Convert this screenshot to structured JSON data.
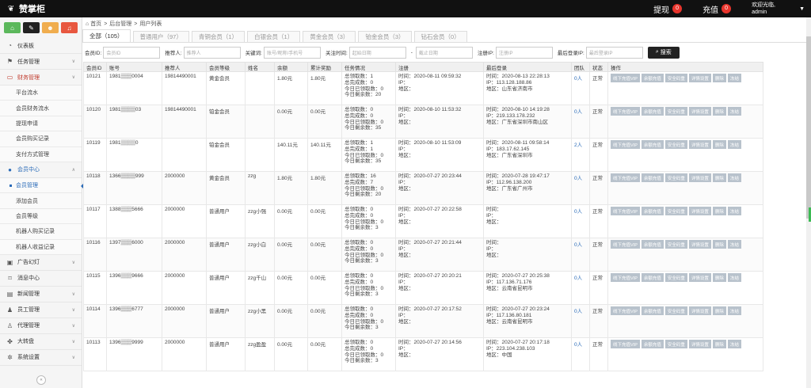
{
  "brand": {
    "name": "赞掌柜",
    "icon": "leaf-icon"
  },
  "topbar": {
    "withdraw_label": "提现",
    "withdraw_count": "0",
    "recharge_label": "充值",
    "recharge_count": "0",
    "welcome": "欢迎光临,",
    "username": "admin"
  },
  "sidebar": {
    "quick": [
      "home-icon",
      "pencil-icon",
      "group-icon",
      "bell-icon"
    ],
    "items": [
      {
        "label": "仪表板",
        "icon": "gauge-icon",
        "chev": ""
      },
      {
        "label": "任务管理",
        "icon": "flag-icon",
        "chev": "∨"
      },
      {
        "label": "财务管理",
        "icon": "card-icon",
        "chev": "∨",
        "state": "active"
      },
      {
        "label": "平台流水",
        "sub": true
      },
      {
        "label": "会员财务流水",
        "sub": true
      },
      {
        "label": "提现申请",
        "sub": true
      },
      {
        "label": "会员购买记录",
        "sub": true
      },
      {
        "label": "支付方式管理",
        "sub": true
      },
      {
        "label": "会员中心",
        "icon": "user-icon",
        "chev": "∧",
        "state": "active-blue"
      },
      {
        "label": "会员管理",
        "sub": true,
        "current": true
      },
      {
        "label": "添加会员",
        "sub": true
      },
      {
        "label": "会员等级",
        "sub": true
      },
      {
        "label": "机器人购买记录",
        "sub": true
      },
      {
        "label": "机器人收益记录",
        "sub": true
      },
      {
        "label": "广告幻灯",
        "icon": "image-icon",
        "chev": "∨"
      },
      {
        "label": "消息中心",
        "icon": "bookmark-icon",
        "chev": ""
      },
      {
        "label": "新闻管理",
        "icon": "news-icon",
        "chev": "∨"
      },
      {
        "label": "员工管理",
        "icon": "staff-icon",
        "chev": "∨"
      },
      {
        "label": "代理管理",
        "icon": "agent-icon",
        "chev": "∨"
      },
      {
        "label": "大转盘",
        "icon": "wheel-icon",
        "chev": "∨"
      },
      {
        "label": "系统设置",
        "icon": "gear-icon",
        "chev": "∨"
      }
    ]
  },
  "breadcrumb": [
    "首页",
    "后台管理",
    "用户列表"
  ],
  "tabs": [
    {
      "label": "全部（105）",
      "active": true
    },
    {
      "label": "普通用户（97）"
    },
    {
      "label": "青铜会员（1）"
    },
    {
      "label": "白银会员（1）"
    },
    {
      "label": "黄金会员（3）"
    },
    {
      "label": "铂金会员（3）"
    },
    {
      "label": "钻石会员（0）"
    }
  ],
  "filters": {
    "member_id_label": "会员ID:",
    "member_id_ph": "会员ID",
    "referrer_label": "推荐人:",
    "referrer_ph": "推荐人",
    "keyword_label": "关键词:",
    "keyword_ph": "账号/昵称/手机号",
    "follow_time_label": "关注时间:",
    "start_ph": "起始日期",
    "dash": "-",
    "end_ph": "截止日期",
    "reg_ip_label": "注册IP:",
    "reg_ip_ph": "注册IP",
    "last_ip_label": "最后登录IP:",
    "last_ip_ph": "最后登录IP",
    "search_label": "搜索"
  },
  "table": {
    "headers": [
      "会员ID",
      "账号",
      "推荐人",
      "会员等级",
      "姓名",
      "余额",
      "累计奖励",
      "任务情况",
      "注册",
      "最后登录",
      "团队",
      "状态",
      "操作"
    ],
    "ops": [
      "线下充值VIP",
      "余额充值",
      "安全码重",
      "详情设置",
      "删除",
      "冻结"
    ],
    "rows": [
      {
        "id": "10121",
        "account": "1981▒▒▒0004",
        "referrer": "19814490001",
        "level": "黄金会员",
        "name": "",
        "balance": "1.80元",
        "reward": "1.80元",
        "task": [
          "总领取数：1",
          "总完成数：0",
          "今日已领取数：0",
          "今日剩余数：20"
        ],
        "reg": [
          "时间：2020-08-11 09:59:32",
          "IP：",
          "地区："
        ],
        "last": [
          "时间：2020-08-13 22:28:13",
          "IP：113.128.188.86",
          "地区：山东省济南市"
        ],
        "team": "0人",
        "status": "正常"
      },
      {
        "id": "10120",
        "account": "1981▒▒▒▒03",
        "referrer": "19814490001",
        "level": "铂金会员",
        "name": "",
        "balance": "0.00元",
        "reward": "0.00元",
        "task": [
          "总领取数：0",
          "总完成数：0",
          "今日已领取数：0",
          "今日剩余数：35"
        ],
        "reg": [
          "时间：2020-08-10 11:53:32",
          "IP：",
          "地区："
        ],
        "last": [
          "时间：2020-08-10 14:19:28",
          "IP：219.133.178.232",
          "地区：广东省深圳市南山区"
        ],
        "team": "0人",
        "status": "正常"
      },
      {
        "id": "10119",
        "account": "1981▒▒▒▒0",
        "referrer": "",
        "level": "铂金会员",
        "name": "",
        "balance": "140.11元",
        "reward": "140.11元",
        "task": [
          "总领取数：1",
          "总完成数：1",
          "今日已领取数：0",
          "今日剩余数：35"
        ],
        "reg": [
          "时间：2020-08-10 11:53:09",
          "IP：",
          "地区："
        ],
        "last": [
          "时间：2020-08-11 09:58:14",
          "IP：183.17.62.145",
          "地区：广东省深圳市"
        ],
        "team": "2人",
        "status": "正常"
      },
      {
        "id": "10118",
        "account": "1366▒▒▒▒999",
        "referrer": "2000000",
        "level": "黄金会员",
        "name": "zzg",
        "balance": "1.80元",
        "reward": "1.80元",
        "task": [
          "总领取数：16",
          "总完成数：7",
          "今日已领取数：0",
          "今日剩余数：20"
        ],
        "reg": [
          "时间：2020-07-27 20:23:44",
          "IP：",
          "地区："
        ],
        "last": [
          "时间：2020-07-28 19:47:17",
          "IP：112.96.138.200",
          "地区：广东省广州市"
        ],
        "team": "0人",
        "status": "正常"
      },
      {
        "id": "10117",
        "account": "1388▒▒▒5666",
        "referrer": "2000000",
        "level": "普通用户",
        "name": "zzg小强",
        "balance": "0.00元",
        "reward": "0.00元",
        "task": [
          "总领取数：0",
          "总完成数：0",
          "今日已领取数：0",
          "今日剩余数：3"
        ],
        "reg": [
          "时间：2020-07-27 20:22:58",
          "IP：",
          "地区："
        ],
        "last": [
          "时间：",
          "IP：",
          "地区："
        ],
        "team": "0人",
        "status": "正常"
      },
      {
        "id": "10116",
        "account": "1397▒▒▒6000",
        "referrer": "2000000",
        "level": "普通用户",
        "name": "zzg小白",
        "balance": "0.00元",
        "reward": "0.00元",
        "task": [
          "总领取数：0",
          "总完成数：0",
          "今日已领取数：0",
          "今日剩余数：3"
        ],
        "reg": [
          "时间：2020-07-27 20:21:44",
          "IP：",
          "地区："
        ],
        "last": [
          "时间：",
          "IP：",
          "地区："
        ],
        "team": "0人",
        "status": "正常"
      },
      {
        "id": "10115",
        "account": "1396▒▒▒9666",
        "referrer": "2000000",
        "level": "普通用户",
        "name": "zzg千山",
        "balance": "0.00元",
        "reward": "0.00元",
        "task": [
          "总领取数：0",
          "总完成数：0",
          "今日已领取数：0",
          "今日剩余数：3"
        ],
        "reg": [
          "时间：2020-07-27 20:20:21",
          "IP：",
          "地区："
        ],
        "last": [
          "时间：2020-07-27 20:25:38",
          "IP：117.136.71.176",
          "地区：云南省昆明市"
        ],
        "team": "0人",
        "status": "正常"
      },
      {
        "id": "10114",
        "account": "1396▒▒▒6777",
        "referrer": "2000000",
        "level": "普通用户",
        "name": "zzg小黑",
        "balance": "0.00元",
        "reward": "0.00元",
        "task": [
          "总领取数：0",
          "总完成数：0",
          "今日已领取数：0",
          "今日剩余数：3"
        ],
        "reg": [
          "时间：2020-07-27 20:17:52",
          "IP：",
          "地区："
        ],
        "last": [
          "时间：2020-07-27 20:23:24",
          "IP：117.136.80.181",
          "地区：云南省昆明市"
        ],
        "team": "0人",
        "status": "正常"
      },
      {
        "id": "10113",
        "account": "1396▒▒▒9999",
        "referrer": "2000000",
        "level": "普通用户",
        "name": "zzg盈盈",
        "balance": "0.00元",
        "reward": "0.00元",
        "task": [
          "总领取数：0",
          "总完成数：0",
          "今日已领取数：0",
          "今日剩余数：3"
        ],
        "reg": [
          "时间：2020-07-27 20:14:56",
          "IP：",
          "地区："
        ],
        "last": [
          "时间：2020-07-27 20:17:18",
          "IP：223.104.238.103",
          "地区：中国"
        ],
        "team": "0人",
        "status": "正常"
      }
    ]
  }
}
